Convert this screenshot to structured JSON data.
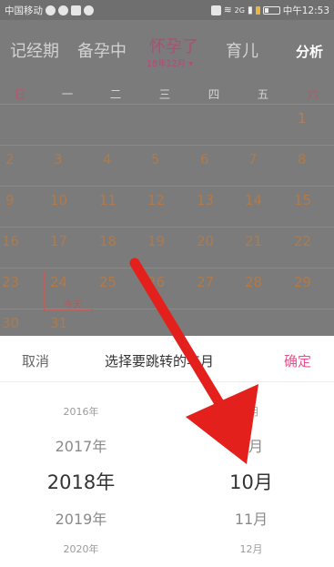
{
  "status_bar": {
    "carrier": "中国移动",
    "signal": "2G",
    "time": "中午12:53"
  },
  "tabs": [
    {
      "label": "记经期"
    },
    {
      "label": "备孕中"
    },
    {
      "label": "怀孕了",
      "sub": "18年12月 ▾"
    },
    {
      "label": "育儿"
    }
  ],
  "analyze_label": "分析",
  "weekdays": [
    "日",
    "一",
    "二",
    "三",
    "四",
    "五",
    "六"
  ],
  "days": {
    "row1": [
      "1"
    ],
    "row2": [
      "2",
      "3",
      "4",
      "5",
      "6",
      "7",
      "8"
    ],
    "row3": [
      "9",
      "10",
      "11",
      "12",
      "13",
      "14",
      "15"
    ],
    "row4": [
      "16",
      "17",
      "18",
      "19",
      "20",
      "21",
      "22"
    ],
    "row5": [
      "23",
      "24",
      "25",
      "26",
      "27",
      "28",
      "29"
    ],
    "row6": [
      "30",
      "31"
    ]
  },
  "today_label": "今天",
  "picker": {
    "cancel": "取消",
    "title": "选择要跳转的年月",
    "confirm": "确定",
    "years": [
      "2016年",
      "2017年",
      "2018年",
      "2019年",
      "2020年"
    ],
    "months": [
      "8月",
      "9月",
      "10月",
      "11月",
      "12月"
    ]
  },
  "colors": {
    "accent": "#e7528d",
    "overlay": "#7b7b7b",
    "arrow": "#e4201c"
  }
}
